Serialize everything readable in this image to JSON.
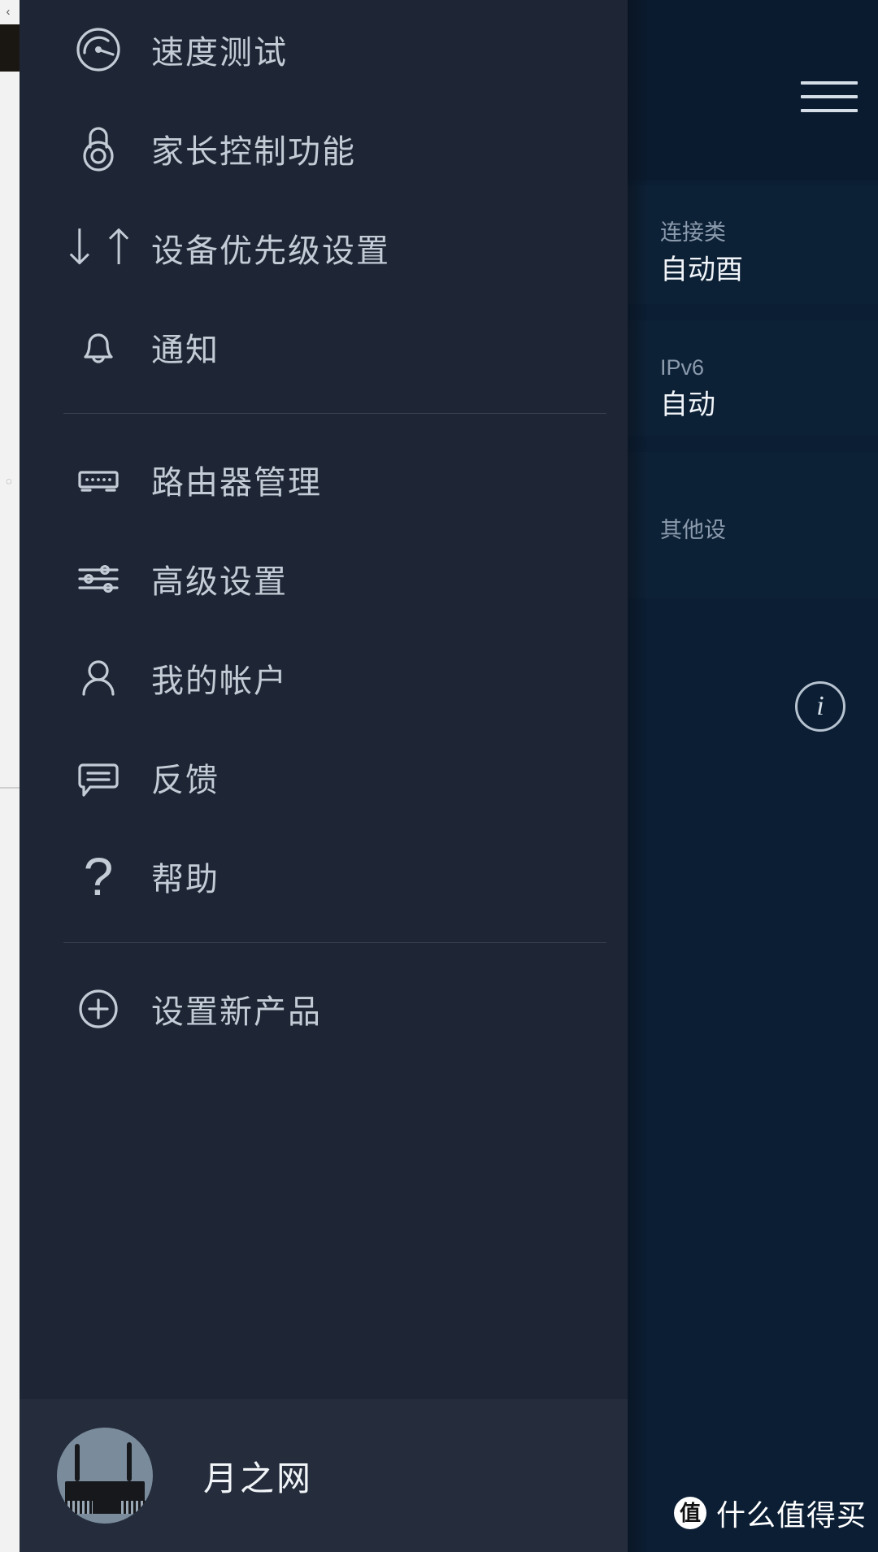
{
  "app": {
    "network_name": "月之网",
    "accent_bg_drawer": "#1e2635",
    "accent_bg_panel": "#0b1e34",
    "text_color": "#c3ccd6"
  },
  "drawer": {
    "groups": [
      {
        "items": [
          {
            "icon": "speedometer-icon",
            "label": "速度测试"
          },
          {
            "icon": "padlock-icon",
            "label": "家长控制功能"
          },
          {
            "icon": "up-down-arrows-icon",
            "label": "设备优先级设置"
          },
          {
            "icon": "bell-icon",
            "label": "通知"
          }
        ]
      },
      {
        "items": [
          {
            "icon": "router-icon",
            "label": "路由器管理"
          },
          {
            "icon": "sliders-icon",
            "label": "高级设置"
          },
          {
            "icon": "person-icon",
            "label": "我的帐户"
          },
          {
            "icon": "chat-bubble-icon",
            "label": "反馈"
          },
          {
            "icon": "question-mark-icon",
            "label": "帮助"
          }
        ]
      },
      {
        "items": [
          {
            "icon": "plus-circle-icon",
            "label": "设置新产品"
          }
        ]
      }
    ]
  },
  "footer": {
    "avatar_icon": "router-avatar",
    "network_label": "月之网"
  },
  "right_panel": {
    "menu_icon": "hamburger-icon",
    "cards": [
      {
        "label": "连接类",
        "value": "自动酉"
      },
      {
        "label": "IPv6",
        "value": "自动"
      },
      {
        "label": "其他设",
        "value": ""
      }
    ],
    "info_icon": "info-circle-icon",
    "info_glyph": "i"
  },
  "watermark": {
    "logo_glyph": "值",
    "text": "什么值得买"
  },
  "left_sliver": {
    "back_arrow": "‹",
    "small_glyph": "◌"
  }
}
